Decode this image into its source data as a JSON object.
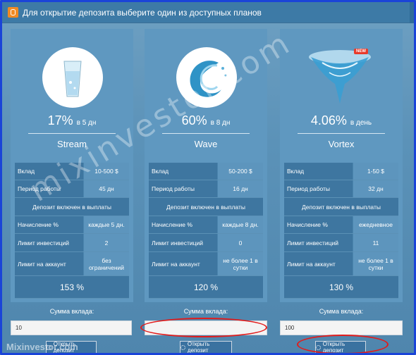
{
  "window": {
    "title": "Для открытие депозита выберите один из доступных планов"
  },
  "labels": {
    "deposit_row": "Вклад",
    "period_row": "Период работы",
    "payout_note": "Депозит включен в выплаты",
    "accrual_row": "Начисление %",
    "limit_row": "Лимит инвестиций",
    "account_limit_row": "Лимит на аккаунт",
    "sum_label": "Сумма вклада:",
    "open_button": "Открыть депозит"
  },
  "plans": [
    {
      "percent": "17%",
      "period": "в 5 дн",
      "name": "Stream",
      "deposit": "10-500 $",
      "work_period": "45 дн",
      "accrual": "каждые 5 дн.",
      "invest_limit": "2",
      "account_limit": "без ограничений",
      "total": "153 %",
      "amount": "10",
      "icon": "water-glass-icon",
      "badge": ""
    },
    {
      "percent": "60%",
      "period": "в 8 дн",
      "name": "Wave",
      "deposit": "50-200 $",
      "work_period": "16 дн",
      "accrual": "каждые 8 дн.",
      "invest_limit": "0",
      "account_limit": "не более 1 в сутки",
      "total": "120 %",
      "amount": "",
      "icon": "water-wave-icon",
      "badge": ""
    },
    {
      "percent": "4.06%",
      "period": "в день",
      "name": "Vortex",
      "deposit": "1-50 $",
      "work_period": "32 дн",
      "accrual": "ежедневное",
      "invest_limit": "11",
      "account_limit": "не более 1 в сутки",
      "total": "130 %",
      "amount": "100",
      "icon": "water-vortex-icon",
      "badge": "NEW"
    }
  ],
  "watermark": {
    "diagonal": "mixinvestor.com",
    "corner": "Mixinvestor.com"
  },
  "colors": {
    "accent": "#f08a24",
    "highlight": "#e21b1b",
    "frame": "#1a44d8"
  }
}
